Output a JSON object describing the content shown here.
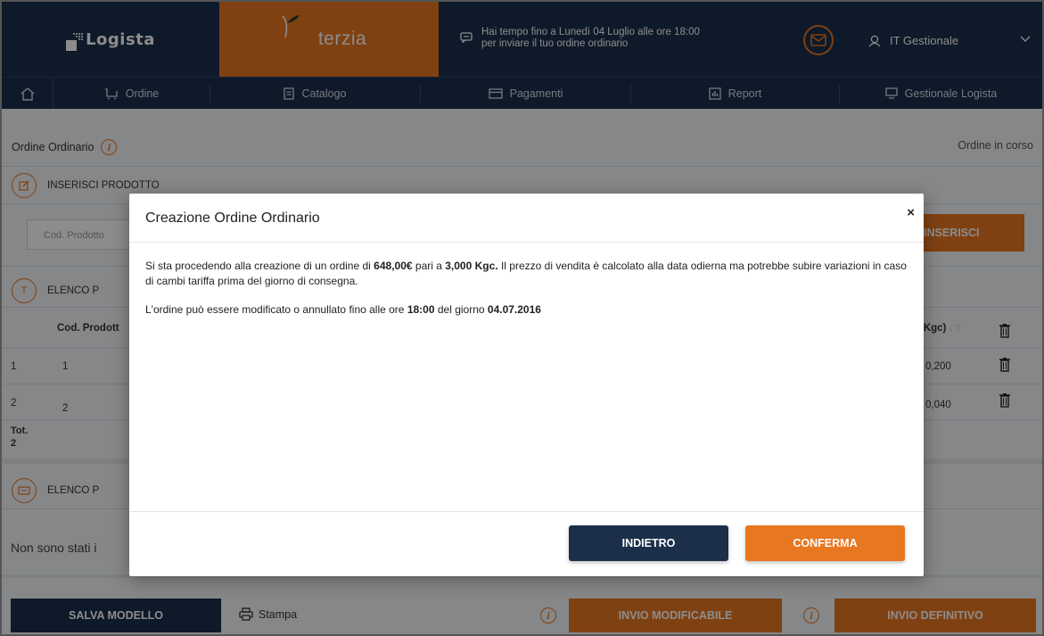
{
  "header": {
    "brand_logista": "Logista",
    "brand_terzia": "Terzia",
    "notice_line1": "Hai tempo fino a Lunedì 04 Luglio alle ore 18:00",
    "notice_line2": "per inviare il tuo ordine ordinario",
    "user_name": "IT Gestionale"
  },
  "nav": {
    "items": [
      {
        "label": "Ordine",
        "icon": "cart-icon"
      },
      {
        "label": "Catalogo",
        "icon": "catalog-icon"
      },
      {
        "label": "Pagamenti",
        "icon": "card-icon"
      },
      {
        "label": "Report",
        "icon": "report-icon"
      },
      {
        "label": "Gestionale Logista",
        "icon": "monitor-icon"
      }
    ]
  },
  "page": {
    "title": "Ordine Ordinario",
    "status": "Ordine in corso",
    "insert_section": "INSERISCI PRODOTTO",
    "code_placeholder": "Cod. Prodotto",
    "insert_button": "INSERISCI",
    "list_section_1": "ELENCO P",
    "list_section_icon_letter": "T",
    "col_code": "Cod. Prodott",
    "col_kg": "(Kgc)",
    "col_kg_sort": "↓ ?",
    "rows": [
      {
        "index": "1",
        "code": "1",
        "kg": "0,200"
      },
      {
        "index": "2",
        "code": "2",
        "kg": "0,040"
      }
    ],
    "tot_label": "Tot.",
    "tot_value": "2",
    "list_section_2": "ELENCO P",
    "empty_text": "Non sono stati i"
  },
  "bottom": {
    "save_model": "SALVA MODELLO",
    "print": "Stampa",
    "send_modifiable": "INVIO MODIFICABILE",
    "send_final": "INVIO DEFINITIVO"
  },
  "modal": {
    "title": "Creazione Ordine Ordinario",
    "close": "×",
    "p1_a": "Si sta procedendo alla creazione di un ordine di ",
    "p1_amount": "648,00€",
    "p1_b": " pari a ",
    "p1_weight": "3,000 Kgc.",
    "p1_c": " Il prezzo di vendita è calcolato alla data odierna ma potrebbe subire variazioni in caso di cambi tariffa prima del giorno di consegna.",
    "p2_a": "L'ordine può essere modificato o annullato fino alle ore ",
    "p2_time": "18:00",
    "p2_b": " del giorno ",
    "p2_date": "04.07.2016",
    "back_button": "INDIETRO",
    "confirm_button": "CONFERMA"
  },
  "colors": {
    "navy": "#1b2f4b",
    "orange": "#e87722",
    "overlay": "rgba(0,0,0,0.45)"
  }
}
